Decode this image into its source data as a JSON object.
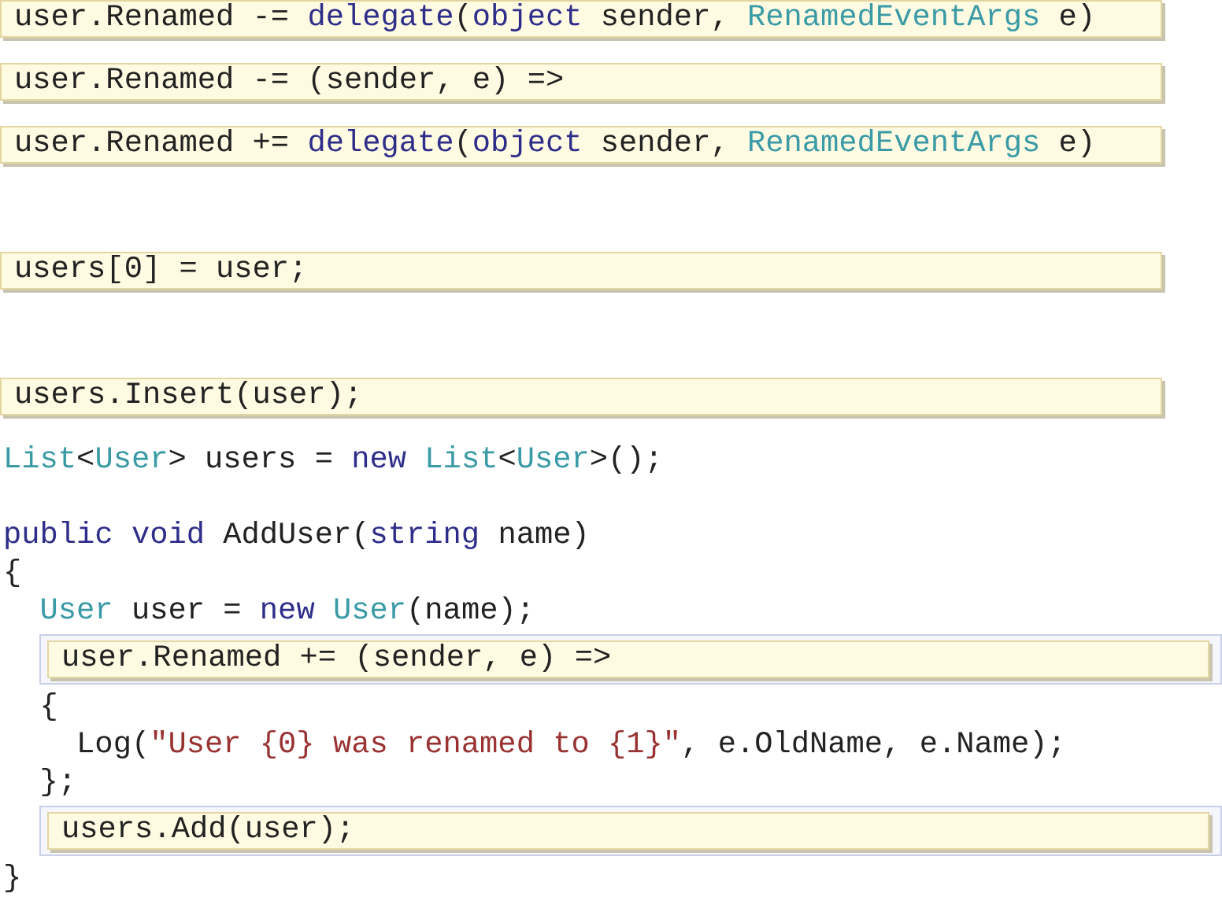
{
  "choices": [
    {
      "kind": "tile",
      "tokens": [
        {
          "text": "user.Renamed -= ",
          "kind": "plain"
        },
        {
          "text": "delegate",
          "kind": "keyword"
        },
        {
          "text": "(",
          "kind": "plain"
        },
        {
          "text": "object",
          "kind": "keyword"
        },
        {
          "text": " sender, ",
          "kind": "plain"
        },
        {
          "text": "RenamedEventArgs",
          "kind": "type"
        },
        {
          "text": " e)",
          "kind": "plain"
        }
      ]
    },
    {
      "kind": "tile",
      "tokens": [
        {
          "text": "user.Renamed -= (sender, e) =>",
          "kind": "plain"
        }
      ]
    },
    {
      "kind": "tile",
      "tokens": [
        {
          "text": "user.Renamed += ",
          "kind": "plain"
        },
        {
          "text": "delegate",
          "kind": "keyword"
        },
        {
          "text": "(",
          "kind": "plain"
        },
        {
          "text": "object",
          "kind": "keyword"
        },
        {
          "text": " sender, ",
          "kind": "plain"
        },
        {
          "text": "RenamedEventArgs",
          "kind": "type"
        },
        {
          "text": " e)",
          "kind": "plain"
        }
      ]
    },
    {
      "kind": "empty"
    },
    {
      "kind": "tile",
      "tokens": [
        {
          "text": "users[0] = user;",
          "kind": "plain"
        }
      ]
    },
    {
      "kind": "empty"
    },
    {
      "kind": "tile",
      "tokens": [
        {
          "text": "users.Insert(user);",
          "kind": "plain"
        }
      ]
    }
  ],
  "code": [
    {
      "kind": "line",
      "tokens": [
        {
          "text": "List",
          "kind": "type"
        },
        {
          "text": "<",
          "kind": "plain"
        },
        {
          "text": "User",
          "kind": "type"
        },
        {
          "text": "> users = ",
          "kind": "plain"
        },
        {
          "text": "new",
          "kind": "keyword"
        },
        {
          "text": " List",
          "kind": "type"
        },
        {
          "text": "<",
          "kind": "plain"
        },
        {
          "text": "User",
          "kind": "type"
        },
        {
          "text": ">();",
          "kind": "plain"
        }
      ]
    },
    {
      "kind": "blank"
    },
    {
      "kind": "line",
      "tokens": [
        {
          "text": "public void",
          "kind": "keyword"
        },
        {
          "text": " AddUser(",
          "kind": "plain"
        },
        {
          "text": "string",
          "kind": "keyword"
        },
        {
          "text": " name)",
          "kind": "plain"
        }
      ]
    },
    {
      "kind": "line",
      "tokens": [
        {
          "text": "{",
          "kind": "plain"
        }
      ]
    },
    {
      "kind": "line",
      "tokens": [
        {
          "text": "  User",
          "kind": "type"
        },
        {
          "text": " user = ",
          "kind": "plain"
        },
        {
          "text": "new",
          "kind": "keyword"
        },
        {
          "text": " User",
          "kind": "type"
        },
        {
          "text": "(name);",
          "kind": "plain"
        }
      ]
    },
    {
      "kind": "slot",
      "tokens": [
        {
          "text": "user.Renamed += (sender, e) =>",
          "kind": "plain"
        }
      ]
    },
    {
      "kind": "line",
      "tokens": [
        {
          "text": "  {",
          "kind": "plain"
        }
      ]
    },
    {
      "kind": "line",
      "tokens": [
        {
          "text": "    Log(",
          "kind": "plain"
        },
        {
          "text": "\"User {0} was renamed to {1}\"",
          "kind": "string"
        },
        {
          "text": ", e.OldName, e.Name);",
          "kind": "plain"
        }
      ]
    },
    {
      "kind": "line",
      "tokens": [
        {
          "text": "  };",
          "kind": "plain"
        }
      ]
    },
    {
      "kind": "slot",
      "tokens": [
        {
          "text": "users.Add(user);",
          "kind": "plain"
        }
      ]
    },
    {
      "kind": "line",
      "tokens": [
        {
          "text": "}",
          "kind": "plain"
        }
      ]
    }
  ]
}
